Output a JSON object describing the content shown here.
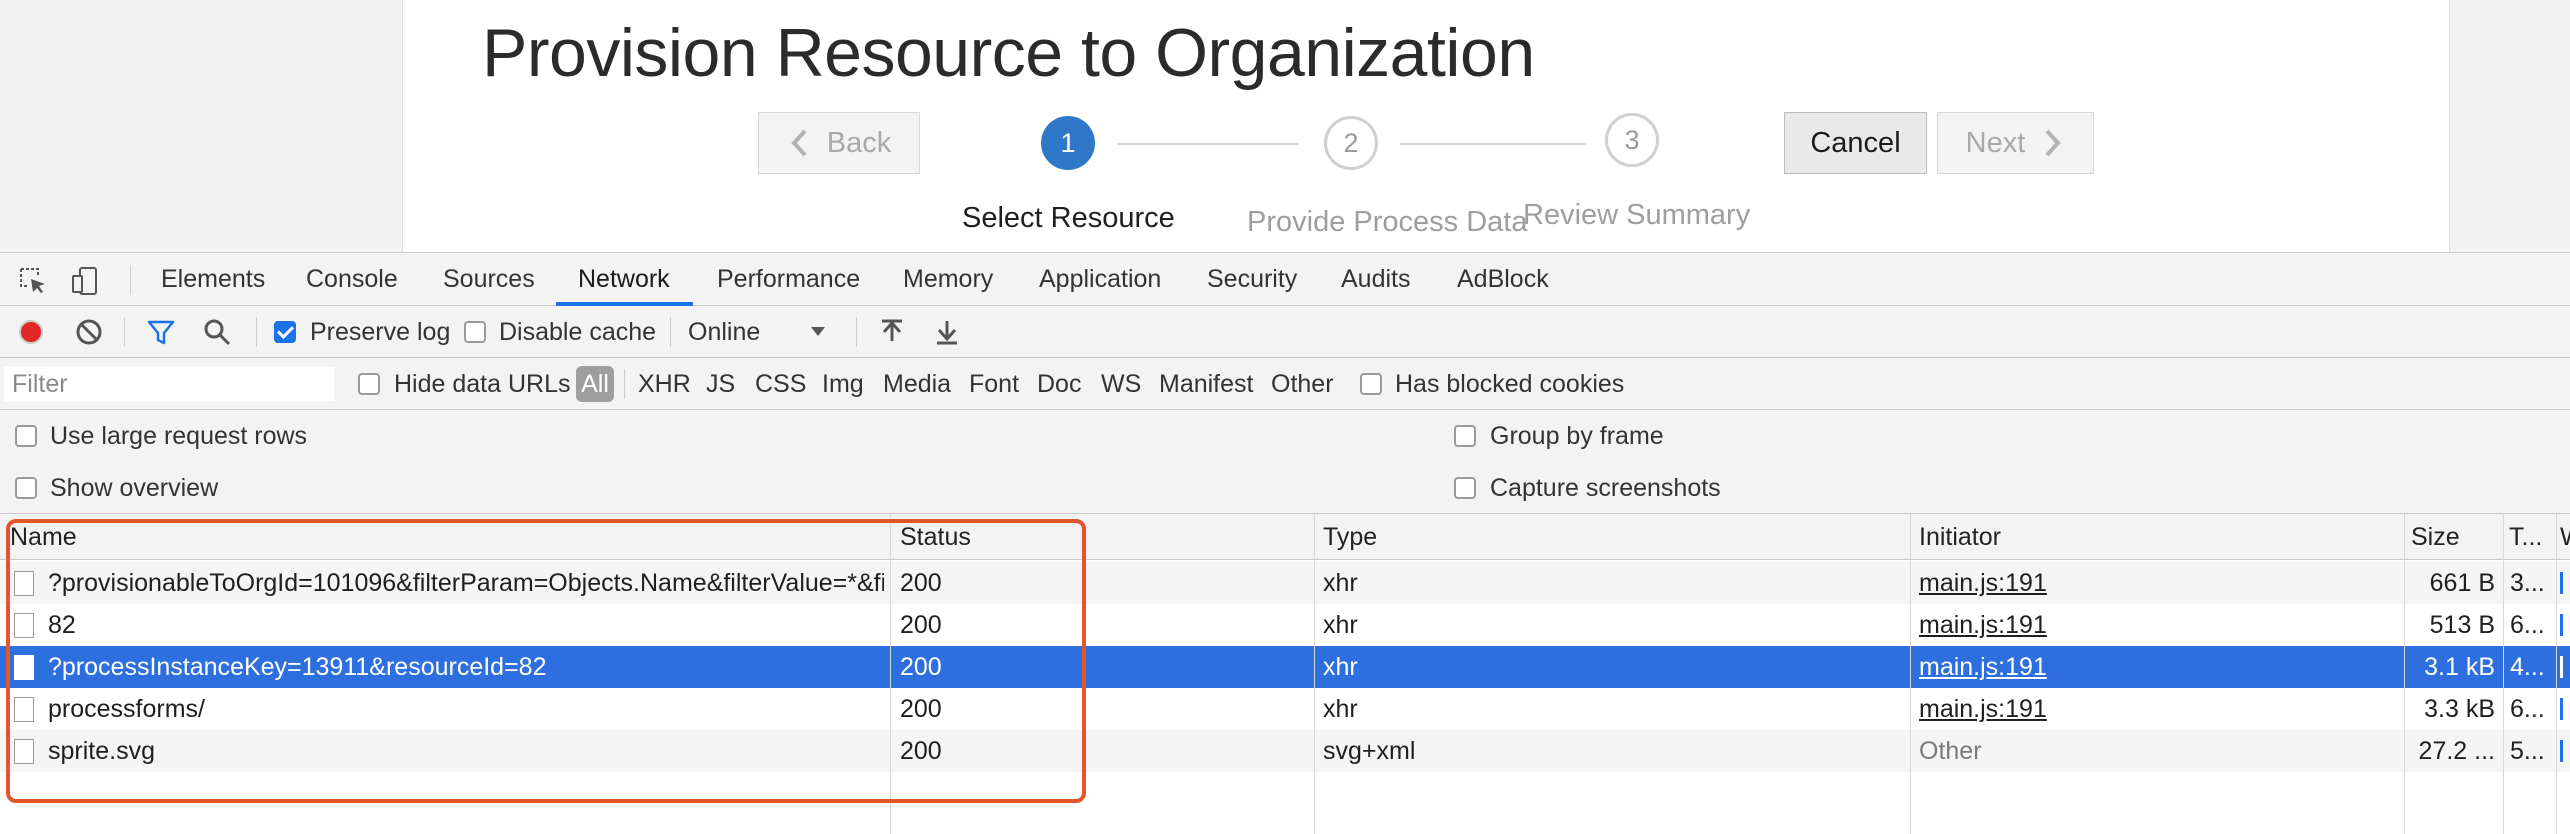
{
  "page": {
    "title": "Provision Resource to Organization",
    "back_label": "Back",
    "cancel_label": "Cancel",
    "next_label": "Next",
    "steps": [
      {
        "number": "1",
        "label": "Select Resource"
      },
      {
        "number": "2",
        "label": "Provide Process Data"
      },
      {
        "number": "3",
        "label": "Review Summary"
      }
    ],
    "accent_color": "#2f78c8"
  },
  "devtools": {
    "tabs": [
      "Elements",
      "Console",
      "Sources",
      "Network",
      "Performance",
      "Memory",
      "Application",
      "Security",
      "Audits",
      "AdBlock"
    ],
    "active_tab": "Network",
    "toolbar": {
      "preserve_log": "Preserve log",
      "preserve_log_checked": true,
      "disable_cache": "Disable cache",
      "disable_cache_checked": false,
      "throttling": "Online"
    },
    "filter": {
      "placeholder": "Filter",
      "hide_data_urls": "Hide data URLs",
      "types": [
        "All",
        "XHR",
        "JS",
        "CSS",
        "Img",
        "Media",
        "Font",
        "Doc",
        "WS",
        "Manifest",
        "Other"
      ],
      "active_type": "All",
      "has_blocked_cookies": "Has blocked cookies"
    },
    "options": {
      "large_rows": "Use large request rows",
      "show_overview": "Show overview",
      "group_by_frame": "Group by frame",
      "capture_screenshots": "Capture screenshots"
    },
    "table": {
      "headers": {
        "name": "Name",
        "status": "Status",
        "type": "Type",
        "initiator": "Initiator",
        "size": "Size",
        "time": "T...",
        "waterfall": "W"
      },
      "rows": [
        {
          "name": "?provisionableToOrgId=101096&filterParam=Objects.Name&filterValue=*&fi...",
          "status": "200",
          "type": "xhr",
          "initiator": "main.js:191",
          "size": "661 B",
          "time": "3..."
        },
        {
          "name": "82",
          "status": "200",
          "type": "xhr",
          "initiator": "main.js:191",
          "size": "513 B",
          "time": "6..."
        },
        {
          "name": "?processInstanceKey=13911&resourceId=82",
          "status": "200",
          "type": "xhr",
          "initiator": "main.js:191",
          "size": "3.1 kB",
          "time": "4..."
        },
        {
          "name": "processforms/",
          "status": "200",
          "type": "xhr",
          "initiator": "main.js:191",
          "size": "3.3 kB",
          "time": "6..."
        },
        {
          "name": "sprite.svg",
          "status": "200",
          "type": "svg+xml",
          "initiator": "Other",
          "size": "27.2 ...",
          "time": "5..."
        }
      ],
      "selected_row": 2,
      "selection_color": "#2d6fde",
      "highlight_color": "#e2552d"
    }
  }
}
